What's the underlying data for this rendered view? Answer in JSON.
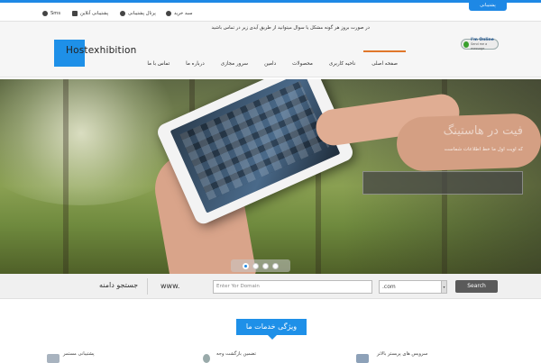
{
  "topbar": {
    "support_tab": "پشتیبانی",
    "links": [
      {
        "label": "سبد خرید",
        "icon": "globe-icon"
      },
      {
        "label": "پرتال پشتیبانی",
        "icon": "globe-icon"
      },
      {
        "label": "پشتیبانی آنلاین",
        "icon": "chat-icon"
      },
      {
        "label": "Sms",
        "icon": "headset-icon"
      }
    ]
  },
  "header": {
    "notice": "در صورت بروز هر گونه مشکل یا سوال میتوانید از طریق آیدی زیر در تماس باشید",
    "online_badge": {
      "title": "I'm Online",
      "subtitle": "Send me a message"
    },
    "logo_text": "Hostexhibition"
  },
  "nav": {
    "items": [
      {
        "label": "صفحه اصلی",
        "active": true
      },
      {
        "label": "ناحیه کاربری",
        "active": false
      },
      {
        "label": "محصولات",
        "active": false
      },
      {
        "label": "دامین",
        "active": false
      },
      {
        "label": "سرور مجازی",
        "active": false
      },
      {
        "label": "درباره ما",
        "active": false
      },
      {
        "label": "تماس با ما",
        "active": false
      }
    ],
    "active_color": "#e0772b"
  },
  "hero": {
    "title": "فیت در هاستینگ",
    "subtitle": "که اویت اول ما خط اطلاعات شماست",
    "slides": 4,
    "active_slide": 1
  },
  "domain_search": {
    "title": "جستجو دامنه",
    "prefix": "www.",
    "placeholder": "Enter Yor Domain",
    "tld_selected": ".com",
    "button": "Search"
  },
  "services": {
    "title": "ویژگی خدمات ما",
    "features": [
      {
        "label": "سرویس های پربستر بالاتر"
      },
      {
        "label": "تضمین بازگشت وجه"
      },
      {
        "label": "پشتیبانی مستمر"
      }
    ]
  },
  "colors": {
    "accent": "#1e88e5",
    "button": "#5a5a5a"
  }
}
